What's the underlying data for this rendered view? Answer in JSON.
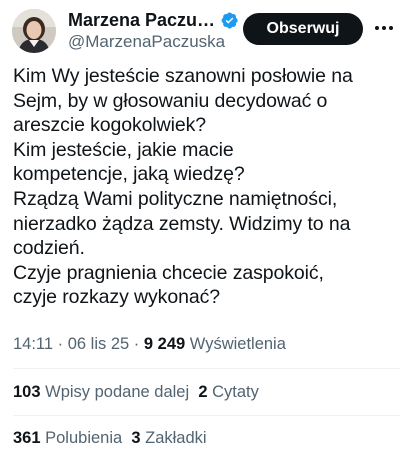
{
  "author": {
    "display_name": "Marzena Paczu…",
    "handle": "@MarzenaPaczuska",
    "verified_icon": "verified-badge-icon",
    "verified_color": "#1d9bf0"
  },
  "follow_button": {
    "label": "Obserwuj"
  },
  "more_icon": "more-dots-icon",
  "tweet": {
    "lines": [
      "Kim Wy jesteście szanowni posłowie na",
      "Sejm,  by w głosowaniu decydować o",
      "areszcie kogokolwiek?",
      "Kim jesteście, jakie macie",
      "kompetencje, jaką wiedzę?",
      "Rządzą Wami polityczne namiętności,",
      "nierzadko żądza zemsty. Widzimy to na",
      "codzień.",
      "Czyje pragnienia chcecie zaspokoić,",
      "czyje rozkazy wykonać?"
    ]
  },
  "meta": {
    "time": "14:11",
    "separator": " · ",
    "date": "06 lis 25",
    "views_count": "9 249",
    "views_label": " Wyświetlenia"
  },
  "stats": {
    "reposts_count": "103",
    "reposts_label": "Wpisy podane dalej",
    "quotes_count": "2",
    "quotes_label": "Cytaty",
    "likes_count": "361",
    "likes_label": "Polubienia",
    "bookmarks_count": "3",
    "bookmarks_label": "Zakładki"
  },
  "colors": {
    "text": "#0f1419",
    "secondary": "#536471",
    "accent": "#1d9bf0",
    "divider": "#eff3f4"
  }
}
